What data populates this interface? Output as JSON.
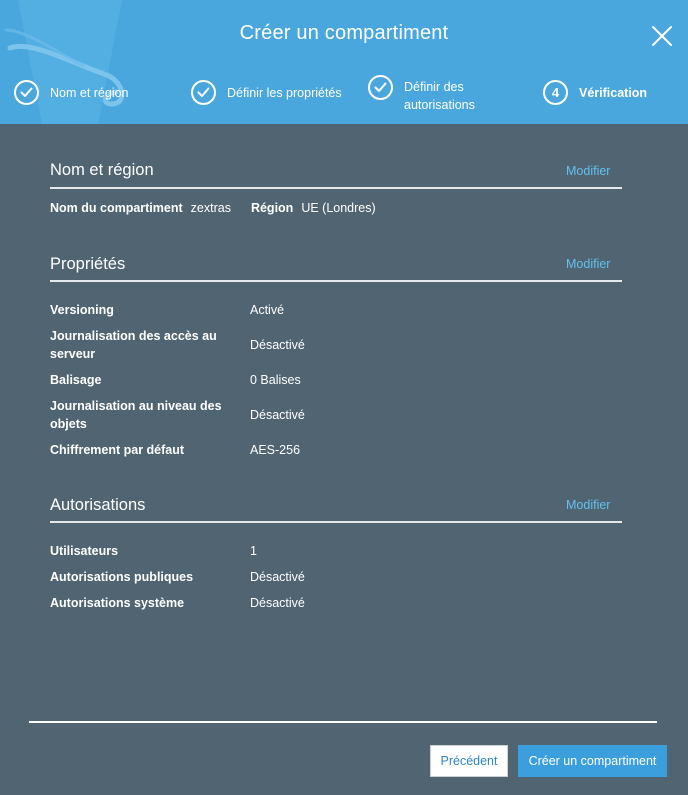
{
  "dialog": {
    "title": "Créer un compartiment"
  },
  "steps": [
    {
      "number": "",
      "label": "Nom et région",
      "state": "completed"
    },
    {
      "number": "",
      "label": "Définir les propriétés",
      "state": "completed"
    },
    {
      "number": "",
      "label": "Définir des autorisations",
      "state": "completed"
    },
    {
      "number": "4",
      "label": "Vérification",
      "state": "current"
    }
  ],
  "sections": {
    "name_region": {
      "title": "Nom et région",
      "modify_label": "Modifier",
      "bucket_name_label": "Nom du compartiment",
      "bucket_name_value": "zextras",
      "region_label": "Région",
      "region_value": "UE (Londres)"
    },
    "properties": {
      "title": "Propriétés",
      "modify_label": "Modifier",
      "rows": [
        {
          "label": "Versioning",
          "value": "Activé"
        },
        {
          "label": "Journalisation des accès au serveur",
          "value": "Désactivé"
        },
        {
          "label": "Balisage",
          "value": "0 Balises"
        },
        {
          "label": "Journalisation au niveau des objets",
          "value": "Désactivé"
        },
        {
          "label": "Chiffrement par défaut",
          "value": "AES-256"
        }
      ]
    },
    "permissions": {
      "title": "Autorisations",
      "modify_label": "Modifier",
      "rows": [
        {
          "label": "Utilisateurs",
          "value": "1"
        },
        {
          "label": "Autorisations publiques",
          "value": "Désactivé"
        },
        {
          "label": "Autorisations système",
          "value": "Désactivé"
        }
      ]
    }
  },
  "footer": {
    "previous_label": "Précédent",
    "create_label": "Créer un compartiment"
  },
  "colors": {
    "header_bg": "#4aa7de",
    "body_bg": "#506471",
    "link": "#62c1f0",
    "primary_button": "#3a9fdc"
  },
  "icons": {
    "close": "close-icon",
    "completed_step": "checkmark-icon"
  }
}
